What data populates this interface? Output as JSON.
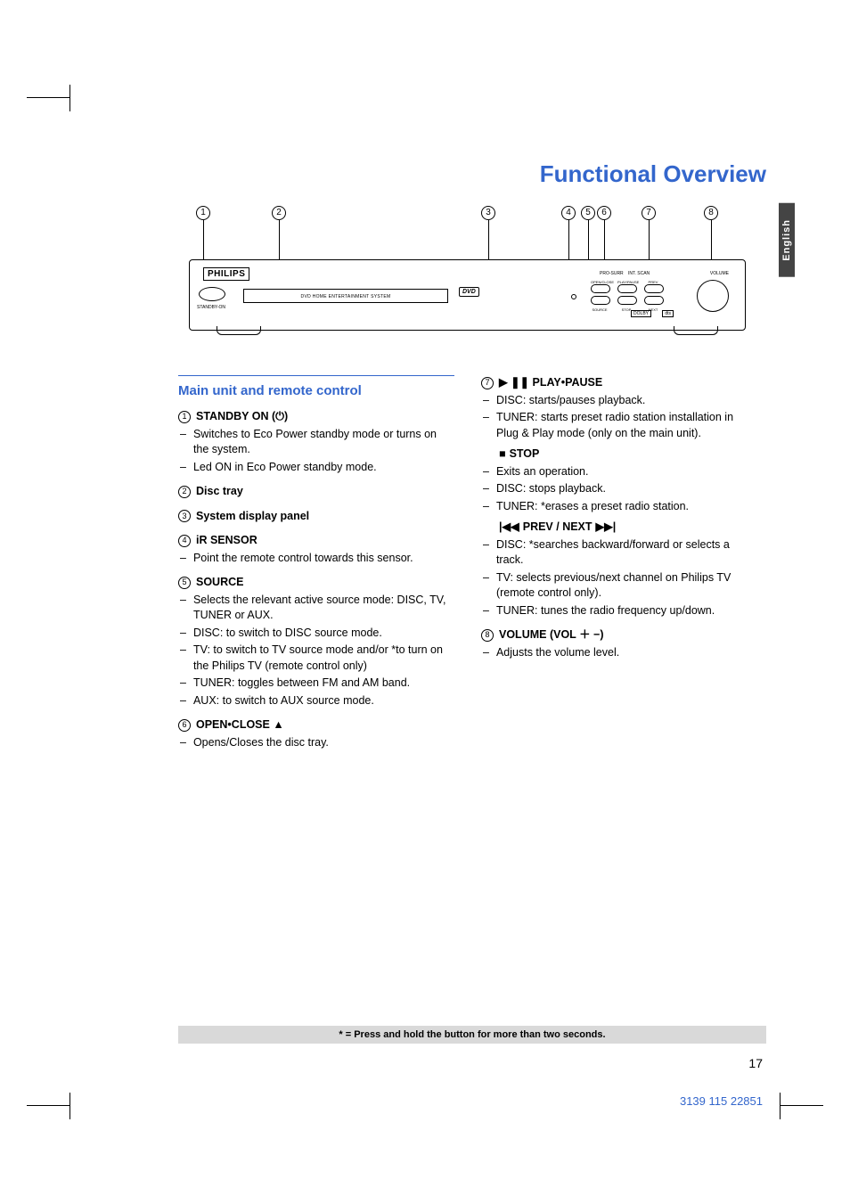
{
  "title": "Functional Overview",
  "language_tab": "English",
  "diagram": {
    "brand": "PHILIPS",
    "display_text": "DVD HOME ENTERTAINMENT SYSTEM",
    "dvd_logo": "DVD",
    "standby_label": "STANDBY-ON",
    "callouts": [
      "1",
      "2",
      "3",
      "4",
      "5",
      "6",
      "7",
      "8"
    ],
    "top_labels": {
      "prosurr": "PRO-SURR",
      "intscan": "INT. SCAN",
      "volume": "VOLUME"
    },
    "cluster_labels": {
      "openclose": "OPEN/CLOSE",
      "source": "SOURCE",
      "playpause": "PLAY/PAUSE",
      "stop": "STOP",
      "prev": "PREV",
      "next": "NEXT"
    },
    "badges": {
      "dolby": "DOLBY",
      "dts": "dts"
    }
  },
  "left": {
    "header": "Main unit and remote control",
    "items": [
      {
        "num": "1",
        "title_prefix": "STANDBY ON (",
        "title_icon": "⏻",
        "title_suffix": ")",
        "bullets": [
          "Switches to Eco Power standby mode or turns on the system.",
          "Led ON in Eco Power standby mode."
        ]
      },
      {
        "num": "2",
        "title": "Disc tray",
        "bullets": []
      },
      {
        "num": "3",
        "title": "System display panel",
        "bullets": []
      },
      {
        "num": "4",
        "title": "iR SENSOR",
        "bullets": [
          "Point the remote control towards this sensor."
        ]
      },
      {
        "num": "5",
        "title": "SOURCE",
        "bullets": [
          "Selects the relevant active source mode: DISC, TV, TUNER or AUX.",
          "DISC: to switch to DISC source mode.",
          "TV: to switch to TV source mode and/or *to turn on the Philips TV (remote control only)",
          "TUNER: toggles between FM and AM band.",
          "AUX: to switch to AUX source mode."
        ]
      },
      {
        "num": "6",
        "title_prefix": "OPEN•CLOSE ",
        "title_icon": "▲",
        "title_suffix": "",
        "bullets": [
          "Opens/Closes the disc tray."
        ]
      }
    ]
  },
  "right": {
    "items": [
      {
        "num": "7",
        "title_prefix": "",
        "title_icon": "▶ ❚❚",
        "title_suffix": " PLAY•PAUSE",
        "bullets": [
          "DISC: starts/pauses playback.",
          "TUNER: starts preset radio station installation in Plug & Play mode (only on the main unit)."
        ],
        "subs": [
          {
            "head_icon": "■",
            "head_text": " STOP",
            "bullets": [
              "Exits an operation.",
              "DISC: stops playback.",
              "TUNER: *erases a preset radio station."
            ]
          },
          {
            "head_icon_pre": "|◀◀",
            "head_text": "  PREV / NEXT  ",
            "head_icon_post": "▶▶|",
            "bullets": [
              "DISC: *searches backward/forward or selects a track.",
              "TV: selects previous/next channel on Philips TV (remote control only).",
              "TUNER: tunes the radio frequency up/down."
            ]
          }
        ]
      },
      {
        "num": "8",
        "title_prefix": "VOLUME (VOL ",
        "title_icon": "＋ −",
        "title_suffix": ")",
        "bullets": [
          "Adjusts the volume level."
        ]
      }
    ]
  },
  "footnote": "* = Press and hold the button for more than two seconds.",
  "page_number": "17",
  "document_number": "3139 115 22851"
}
